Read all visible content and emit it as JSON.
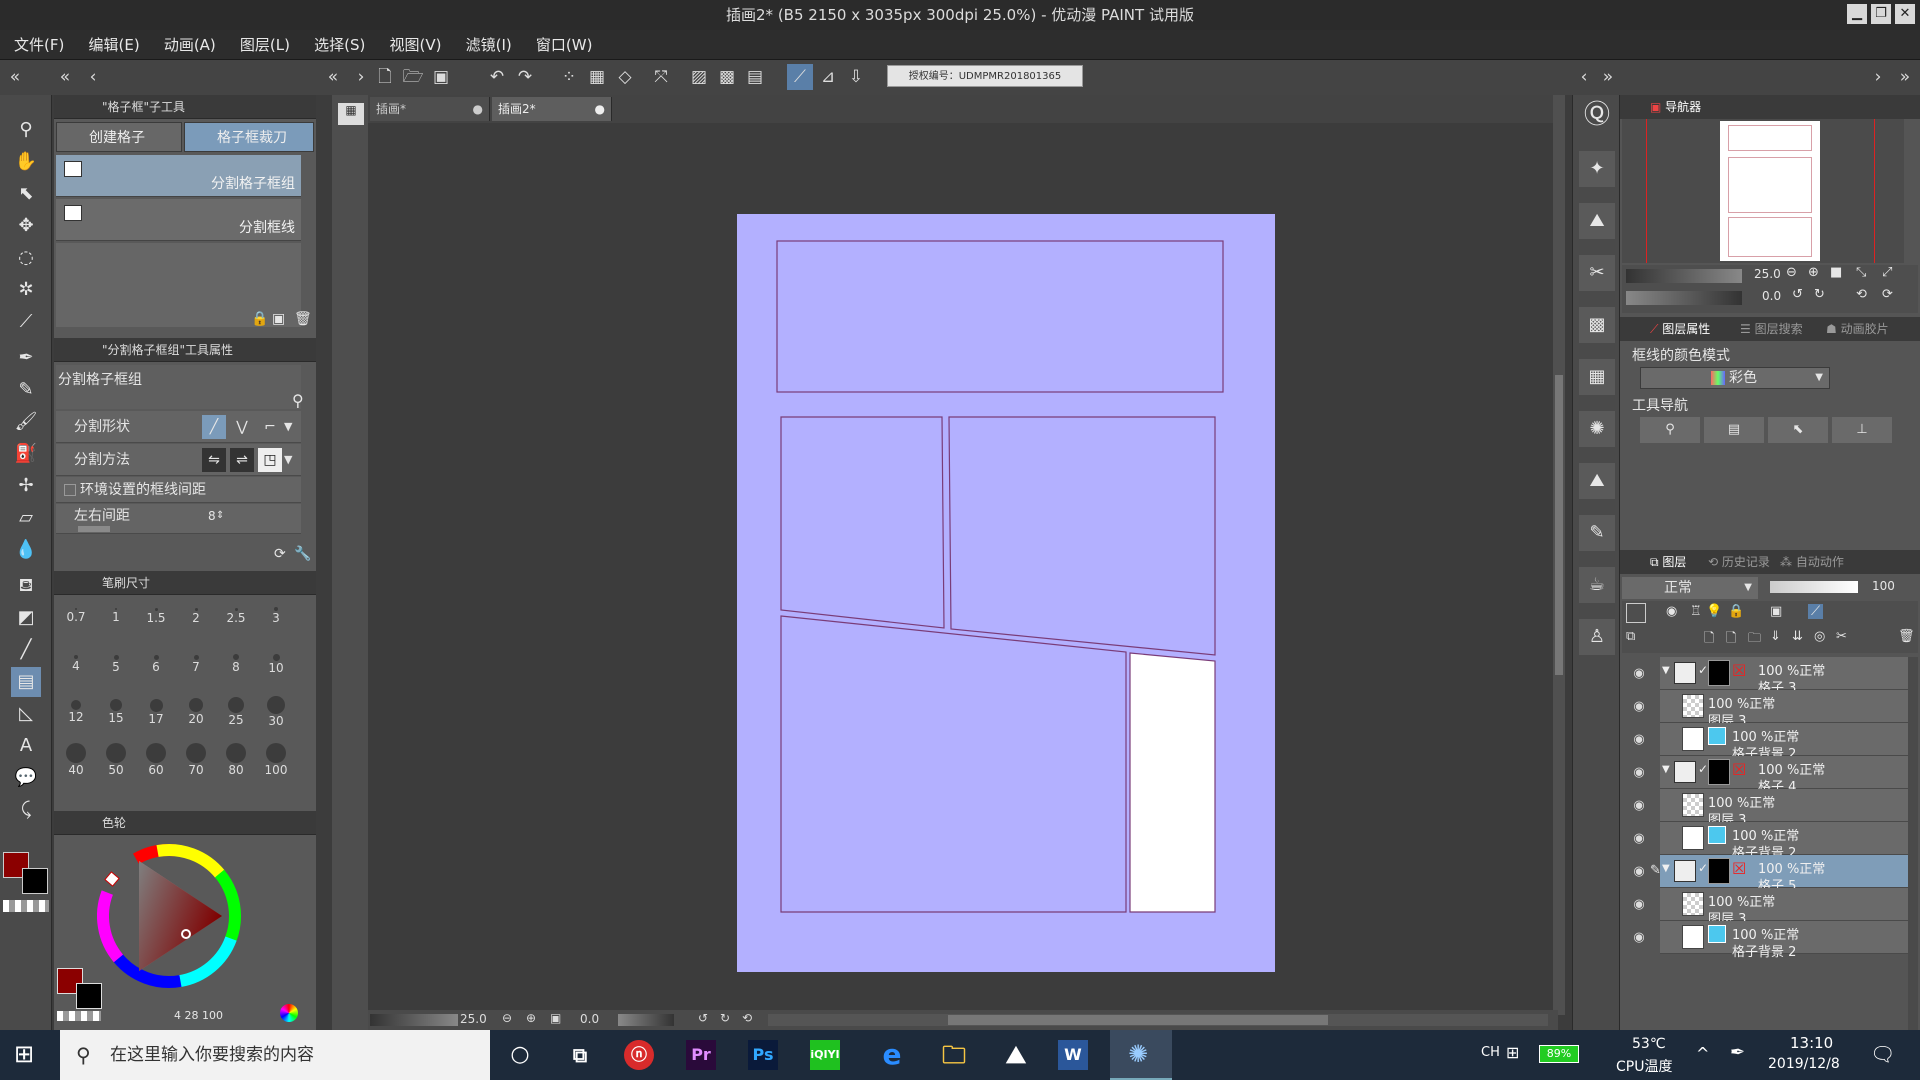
{
  "window": {
    "title": "插画2* (B5 2150 x 3035px 300dpi 25.0%) - 优动漫 PAINT 试用版"
  },
  "menu": [
    "文件(F)",
    "编辑(E)",
    "动画(A)",
    "图层(L)",
    "选择(S)",
    "视图(V)",
    "滤镜(I)",
    "窗口(W)"
  ],
  "license_text": "授权编号：UDMPMR201801365",
  "subtool": {
    "title": "\"格子框\"子工具",
    "tabs": [
      "创建格子",
      "格子框裁刀"
    ],
    "items": [
      "分割格子框组",
      "分割框线"
    ]
  },
  "toolprop": {
    "title": "\"分割格子框组\"工具属性",
    "name": "分割格子框组",
    "rows": {
      "shape": "分割形状",
      "method": "分割方法",
      "gap_check": "环境设置的框线间距",
      "lr_gap": "左右间距",
      "lr_gap_value": "8"
    }
  },
  "brushsize": {
    "title": "笔刷尺寸",
    "sizes": [
      "0.7",
      "1",
      "1.5",
      "2",
      "2.5",
      "3",
      "4",
      "5",
      "6",
      "7",
      "8",
      "10",
      "12",
      "15",
      "17",
      "20",
      "25",
      "30",
      "40",
      "50",
      "60",
      "70",
      "80",
      "100"
    ]
  },
  "colorwheel": {
    "title": "色轮",
    "main_color": "#8b0000",
    "sub_color": "#000000",
    "readout": "4 28 100"
  },
  "doc_tabs": [
    "插画*",
    "插画2*"
  ],
  "canvas_status": {
    "zoom": "25.0",
    "angle": "0.0"
  },
  "navigator": {
    "title": "导航器",
    "zoom": "25.0",
    "angle": "0.0"
  },
  "layer_prop": {
    "tabs": [
      "图层属性",
      "图层搜索",
      "动画胶片"
    ],
    "line_color_label": "框线的颜色模式",
    "line_color_value": "彩色",
    "tool_nav_label": "工具导航"
  },
  "layers_panel": {
    "tabs": [
      "图层",
      "历史记录",
      "自动动作"
    ],
    "blend": "正常",
    "opacity": "100",
    "rows": [
      {
        "t1": "100 %正常",
        "t2": "格子 3",
        "kind": "folder",
        "sel": false
      },
      {
        "t1": "100 %正常",
        "t2": "图层 3",
        "kind": "raster",
        "sel": false
      },
      {
        "t1": "100 %正常",
        "t2": "格子背景 2",
        "kind": "fill",
        "sel": false
      },
      {
        "t1": "100 %正常",
        "t2": "格子 4",
        "kind": "folder",
        "sel": false
      },
      {
        "t1": "100 %正常",
        "t2": "图层 3",
        "kind": "raster",
        "sel": false
      },
      {
        "t1": "100 %正常",
        "t2": "格子背景 2",
        "kind": "fill",
        "sel": false
      },
      {
        "t1": "100 %正常",
        "t2": "格子 5",
        "kind": "folder",
        "sel": true
      },
      {
        "t1": "100 %正常",
        "t2": "图层 3",
        "kind": "raster",
        "sel": false
      },
      {
        "t1": "100 %正常",
        "t2": "格子背景 2",
        "kind": "fill",
        "sel": false
      }
    ]
  },
  "taskbar": {
    "search_placeholder": "在这里输入你要搜索的内容",
    "apps": [
      "网易云",
      "Pr",
      "Ps",
      "iQIYI",
      "e",
      "文件夹",
      "照片",
      "W",
      "优动漫"
    ],
    "battery": "89%",
    "temp": "53℃",
    "temp_label": "CPU温度",
    "ime": "CH",
    "time": "13:10",
    "date": "2019/12/8"
  },
  "colors": {
    "page": "#b3b0ff",
    "frame_line": "#7a3c78",
    "selection": "#7f9db8"
  }
}
